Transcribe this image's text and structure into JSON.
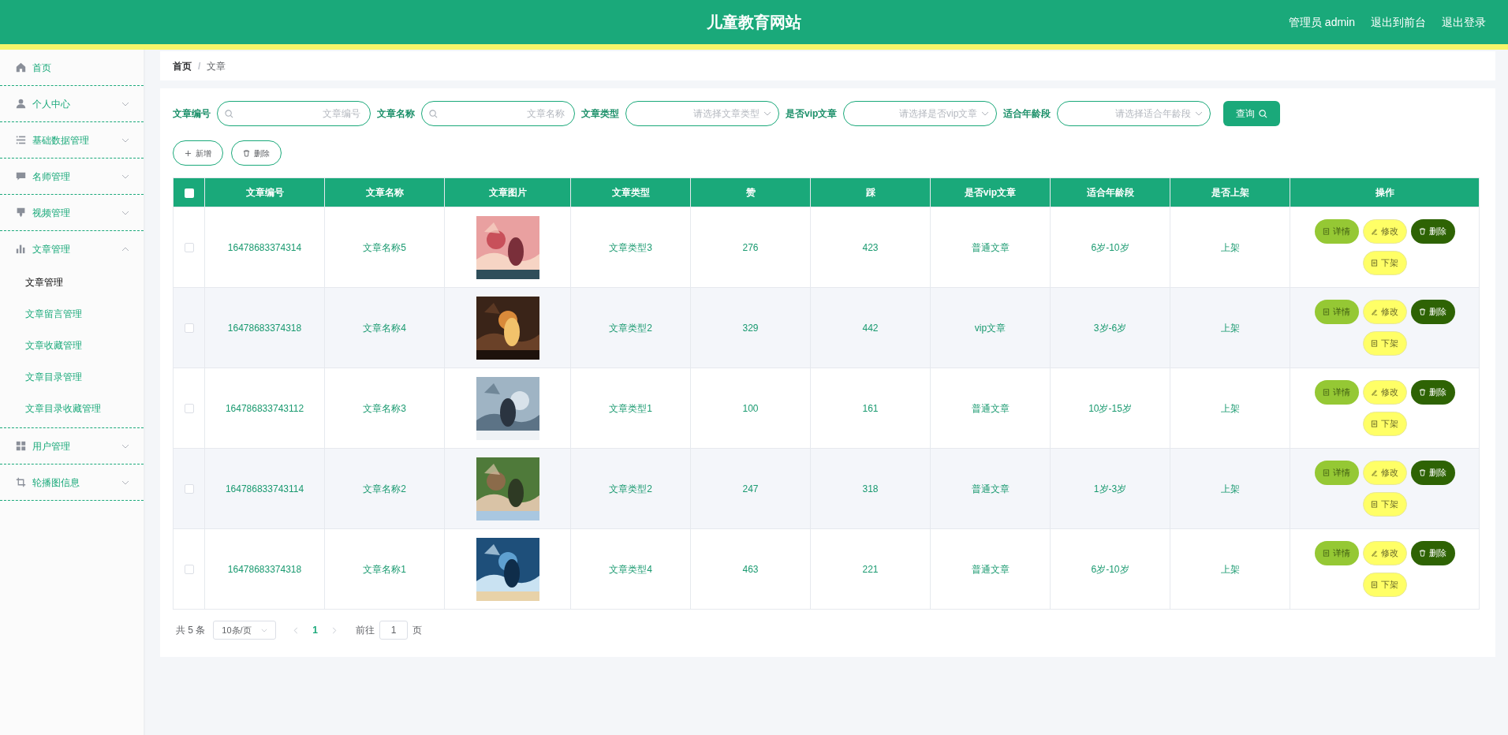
{
  "header": {
    "title": "儿童教育网站",
    "links": [
      "管理员 admin",
      "退出到前台",
      "退出登录"
    ]
  },
  "sidebar": {
    "items": [
      {
        "label": "首页",
        "kind": "link"
      },
      {
        "label": "个人中心",
        "kind": "submenu",
        "expanded": false
      },
      {
        "label": "基础数据管理",
        "kind": "submenu",
        "expanded": false
      },
      {
        "label": "名师管理",
        "kind": "submenu",
        "expanded": false
      },
      {
        "label": "视频管理",
        "kind": "submenu",
        "expanded": false
      },
      {
        "label": "文章管理",
        "kind": "submenu",
        "expanded": true,
        "children": [
          {
            "label": "文章管理",
            "selected": true
          },
          {
            "label": "文章留言管理",
            "selected": false
          },
          {
            "label": "文章收藏管理",
            "selected": false
          },
          {
            "label": "文章目录管理",
            "selected": false
          },
          {
            "label": "文章目录收藏管理",
            "selected": false
          }
        ]
      },
      {
        "label": "用户管理",
        "kind": "submenu",
        "expanded": false
      },
      {
        "label": "轮播图信息",
        "kind": "submenu",
        "expanded": false
      }
    ]
  },
  "breadcrumb": {
    "separator": "/",
    "items": [
      {
        "label": "首页"
      },
      {
        "label": "文章"
      }
    ]
  },
  "filters": [
    {
      "label": "文章编号",
      "kind": "text",
      "placeholder": "文章编号"
    },
    {
      "label": "文章名称",
      "kind": "text",
      "placeholder": "文章名称"
    },
    {
      "label": "文章类型",
      "kind": "select",
      "placeholder": "请选择文章类型"
    },
    {
      "label": "是否vip文章",
      "kind": "select",
      "placeholder": "请选择是否vip文章"
    },
    {
      "label": "适合年龄段",
      "kind": "select",
      "placeholder": "请选择适合年龄段"
    }
  ],
  "query_button": "查询",
  "toolbar": [
    {
      "label": "新增",
      "kind": "add"
    },
    {
      "label": "删除",
      "kind": "delete"
    }
  ],
  "table": {
    "select_all_checked": false,
    "columns": [
      "文章编号",
      "文章名称",
      "文章图片",
      "文章类型",
      "赞",
      "踩",
      "是否vip文章",
      "适合年龄段",
      "是否上架",
      "操作"
    ],
    "rows": [
      {
        "checked": false,
        "cells": [
          "16478683374314",
          "文章名称5",
          {
            "kind": "picture"
          },
          "文章类型3",
          "276",
          "423",
          "普通文章",
          "6岁-10岁",
          "上架"
        ],
        "actions": [
          {
            "label": "详情",
            "kind": "detail"
          },
          {
            "label": "修改",
            "kind": "edit"
          },
          {
            "label": "删除",
            "kind": "delete"
          },
          {
            "label": "下架",
            "kind": "unlist"
          }
        ]
      },
      {
        "checked": false,
        "cells": [
          "16478683374318",
          "文章名称4",
          {
            "kind": "picture"
          },
          "文章类型2",
          "329",
          "442",
          "vip文章",
          "3岁-6岁",
          "上架"
        ],
        "actions": [
          {
            "label": "详情",
            "kind": "detail"
          },
          {
            "label": "修改",
            "kind": "edit"
          },
          {
            "label": "删除",
            "kind": "delete"
          },
          {
            "label": "下架",
            "kind": "unlist"
          }
        ]
      },
      {
        "checked": false,
        "cells": [
          "164786833743112",
          "文章名称3",
          {
            "kind": "picture"
          },
          "文章类型1",
          "100",
          "161",
          "普通文章",
          "10岁-15岁",
          "上架"
        ],
        "actions": [
          {
            "label": "详情",
            "kind": "detail"
          },
          {
            "label": "修改",
            "kind": "edit"
          },
          {
            "label": "删除",
            "kind": "delete"
          },
          {
            "label": "下架",
            "kind": "unlist"
          }
        ]
      },
      {
        "checked": false,
        "cells": [
          "164786833743114",
          "文章名称2",
          {
            "kind": "picture"
          },
          "文章类型2",
          "247",
          "318",
          "普通文章",
          "1岁-3岁",
          "上架"
        ],
        "actions": [
          {
            "label": "详情",
            "kind": "detail"
          },
          {
            "label": "修改",
            "kind": "edit"
          },
          {
            "label": "删除",
            "kind": "delete"
          },
          {
            "label": "下架",
            "kind": "unlist"
          }
        ]
      },
      {
        "checked": false,
        "cells": [
          "16478683374318",
          "文章名称1",
          {
            "kind": "picture"
          },
          "文章类型4",
          "463",
          "221",
          "普通文章",
          "6岁-10岁",
          "上架"
        ],
        "actions": [
          {
            "label": "详情",
            "kind": "detail"
          },
          {
            "label": "修改",
            "kind": "edit"
          },
          {
            "label": "删除",
            "kind": "delete"
          },
          {
            "label": "下架",
            "kind": "unlist"
          }
        ]
      }
    ]
  },
  "pagination": {
    "total": "共 5 条",
    "page_size": "10条/页",
    "pages": [
      {
        "label": "1",
        "selected": true
      }
    ],
    "goto_label": "前往",
    "goto_value": "1",
    "goto_suffix": "页"
  }
}
